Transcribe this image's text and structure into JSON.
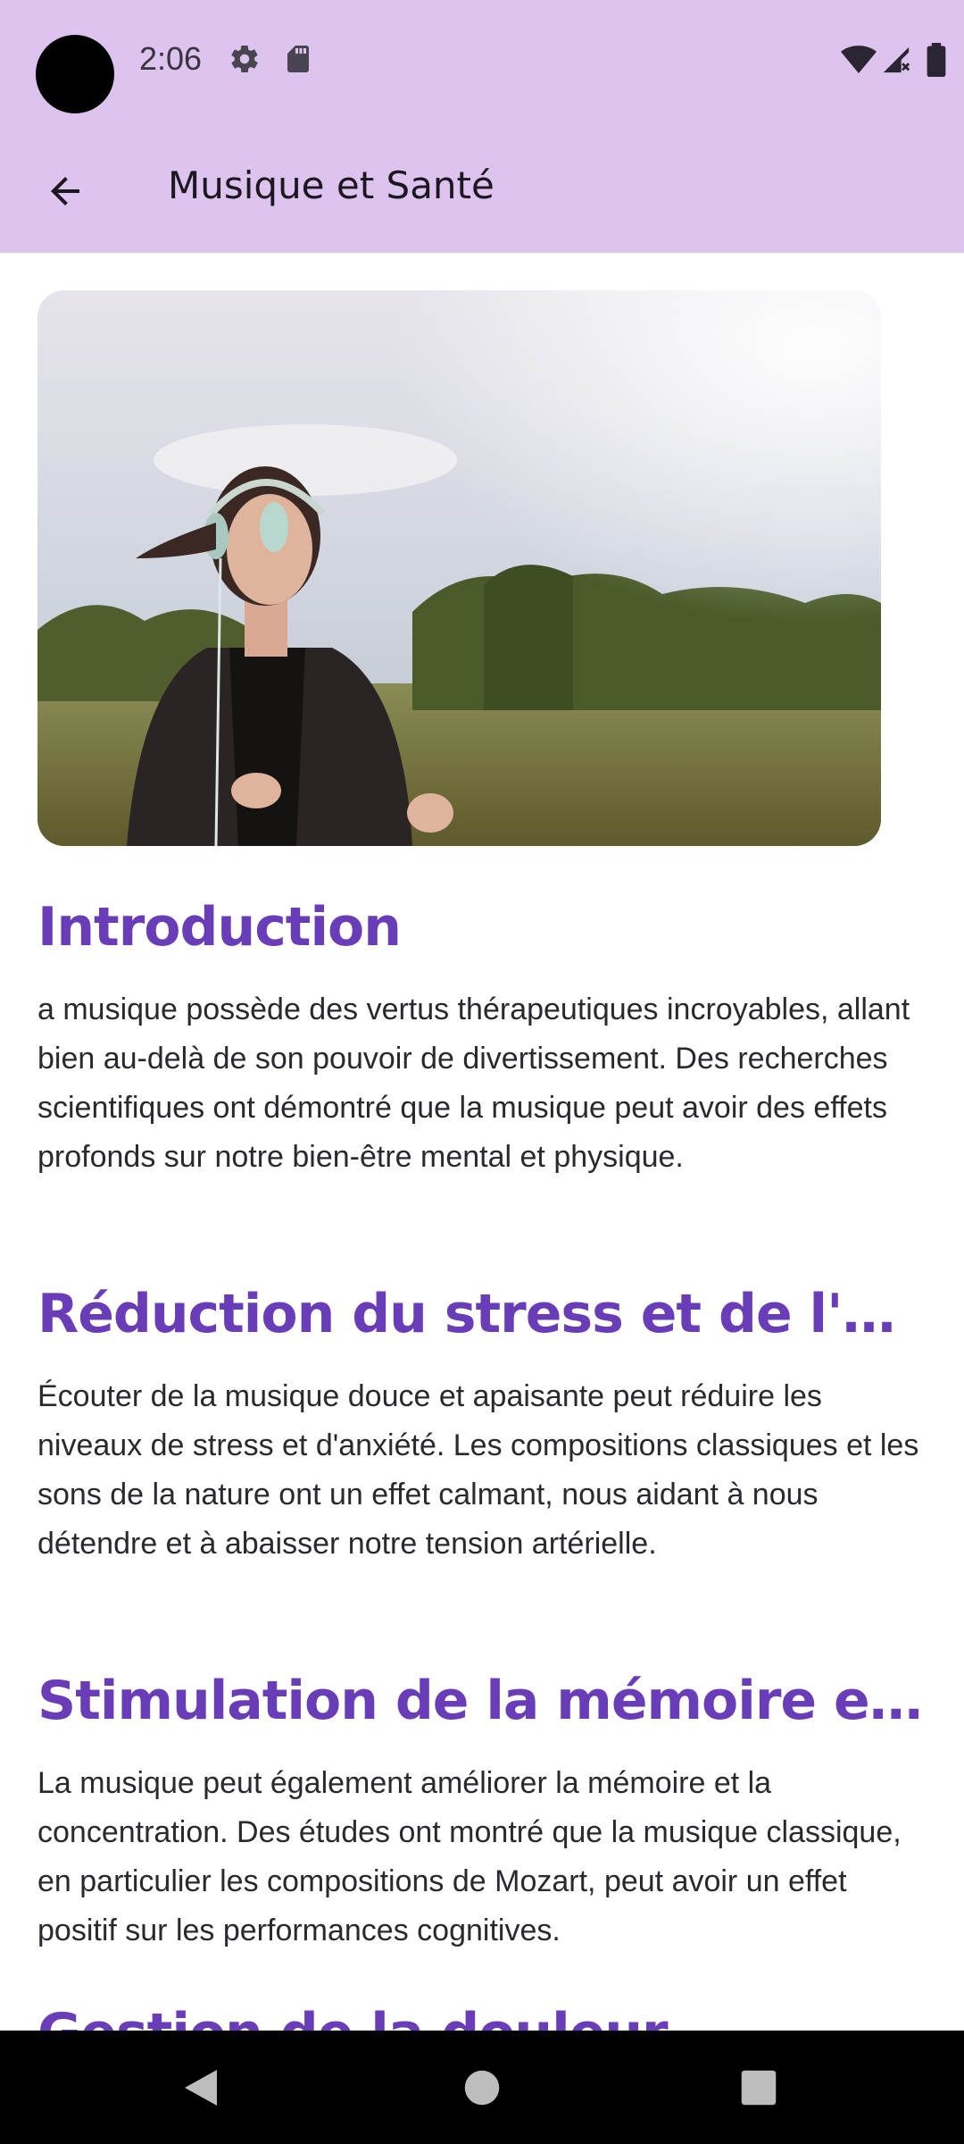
{
  "status_bar": {
    "time": "2:06",
    "icons": [
      "settings-icon",
      "sd-card-icon",
      "wifi-icon",
      "signal-icon",
      "battery-icon"
    ]
  },
  "app_bar": {
    "title": "Musique et Santé",
    "back_icon": "arrow-back-icon"
  },
  "hero": {
    "alt": "woman-running-with-headphones"
  },
  "sections": [
    {
      "title": "Introduction",
      "body": "a musique possède des vertus thérapeutiques incroyables, allant bien au-delà de son pouvoir de divertissement. Des recherches scientifiques ont démontré que la musique peut avoir des effets profonds sur notre bien-être mental et physique."
    },
    {
      "title": "Réduction du stress et de l'anx...",
      "body": "Écouter de la musique douce et apaisante peut réduire les niveaux de stress et d'anxiété. Les compositions classiques et les sons de la nature ont un effet calmant, nous aidant à nous détendre et à abaisser notre tension artérielle."
    },
    {
      "title": "Stimulation de la mémoire et d...",
      "body": "La musique peut également améliorer la mémoire et la concentration. Des études ont montré que la musique classique, en particulier les compositions de Mozart, peut avoir un effet positif sur les performances cognitives."
    },
    {
      "title": "Gestion de la douleur"
    }
  ],
  "colors": {
    "header_bg": "#dcc4ee",
    "accent": "#6a3db8"
  },
  "nav": {
    "back": "nav-back-icon",
    "home": "nav-home-icon",
    "recents": "nav-recents-icon"
  }
}
